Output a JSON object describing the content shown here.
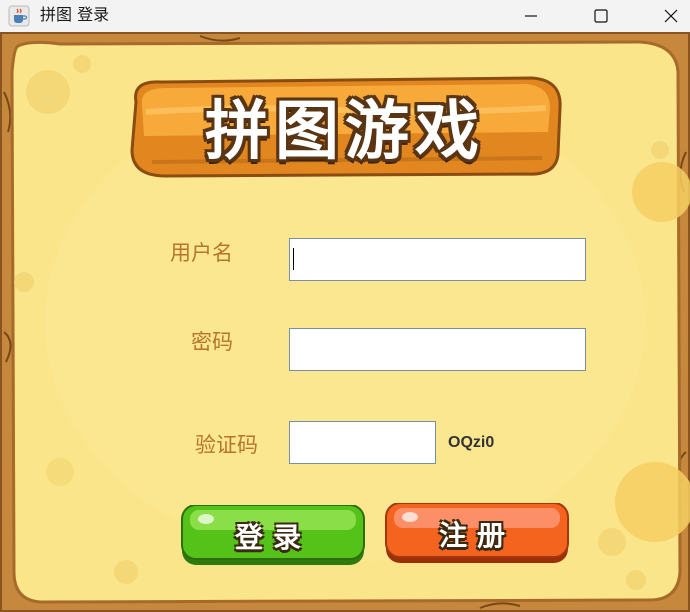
{
  "window": {
    "title": "拼图 登录",
    "icon": "java-coffee-cup-icon",
    "controls": [
      "minimize-icon",
      "maximize-icon",
      "close-icon"
    ]
  },
  "game": {
    "logo_text": "拼图游戏",
    "logo_colors": {
      "board": "#f7a93a",
      "outline": "#5a3514"
    }
  },
  "form": {
    "username": {
      "label": "用户名",
      "value": "",
      "placeholder": ""
    },
    "password": {
      "label": "密码",
      "value": "",
      "placeholder": ""
    },
    "captcha": {
      "label": "验证码",
      "value": "",
      "code": "OQzi0"
    }
  },
  "buttons": {
    "login": {
      "label": "登录",
      "color": "#55c21a"
    },
    "register": {
      "label": "注册",
      "color": "#f4641e"
    }
  },
  "colors": {
    "panel": "#fbe58a",
    "wood_frame": "#c5883c",
    "label_text": "#b5762b"
  }
}
